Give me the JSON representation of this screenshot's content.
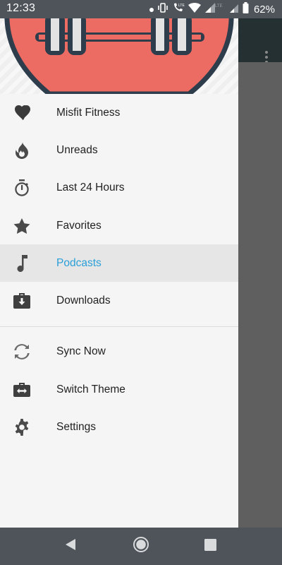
{
  "status_bar": {
    "time": "12:33",
    "battery_percent": "62%",
    "icons": [
      "notification-dot-icon",
      "vibrate-icon",
      "lte-call-icon",
      "wifi-icon",
      "signal-lte-icon",
      "signal-icon",
      "battery-icon"
    ]
  },
  "drawer": {
    "header_image": "dumbbell-logo",
    "primary_items": [
      {
        "label": "Misfit Fitness",
        "icon": "heart-icon"
      },
      {
        "label": "Unreads",
        "icon": "flame-icon"
      },
      {
        "label": "Last 24 Hours",
        "icon": "stopwatch-icon"
      },
      {
        "label": "Favorites",
        "icon": "star-icon"
      },
      {
        "label": "Podcasts",
        "icon": "music-note-icon",
        "active": true
      },
      {
        "label": "Downloads",
        "icon": "download-icon"
      }
    ],
    "secondary_items": [
      {
        "label": "Sync Now",
        "icon": "sync-icon"
      },
      {
        "label": "Switch Theme",
        "icon": "switch-theme-icon"
      },
      {
        "label": "Settings",
        "icon": "gear-icon"
      }
    ]
  },
  "nav_bar": {
    "buttons": [
      "back-icon",
      "home-icon",
      "recents-icon"
    ]
  },
  "colors": {
    "accent": "#2a9fd8",
    "header_red": "#ec6b63",
    "header_navy": "#2e3d4c",
    "system_bars": "#4e545a",
    "scrim": "#5f5f5f"
  }
}
